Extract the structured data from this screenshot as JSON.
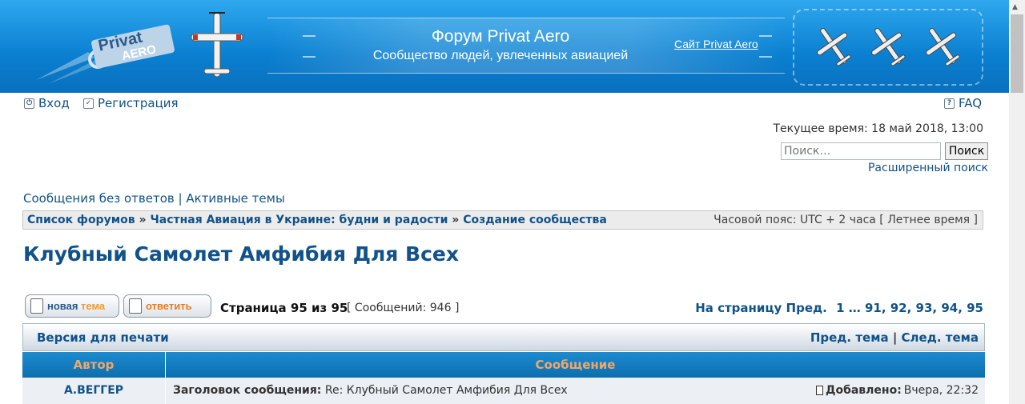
{
  "header": {
    "logo_text_line1": "Privat",
    "logo_text_line2": "AERO",
    "title": "Форум Privat Aero",
    "subtitle": "Сообщество людей, увлеченных авиацией",
    "site_link": "Сайт Privat Aero"
  },
  "nav": {
    "login": "Вход",
    "register": "Регистрация",
    "faq": "FAQ",
    "current_time": "Текущее время: 18 май 2018, 13:00",
    "search_placeholder": "Поиск…",
    "search_button": "Поиск",
    "advanced_search": "Расширенный поиск",
    "unanswered": "Сообщения без ответов",
    "separator": "|",
    "active_topics": "Активные темы"
  },
  "breadcrumb": {
    "items": [
      "Список форумов",
      "Частная Авиация в Украине: будни и радости",
      "Создание сообщества"
    ],
    "sep": "»",
    "timezone": "Часовой пояс: UTC + 2 часа [ Летнее время ]"
  },
  "topic": {
    "title": "Клубный Самолет Амфибия Для Всех",
    "new_topic_label_1": "новая ",
    "new_topic_label_2": "тема",
    "reply_label": "ответить",
    "page_info": "Страница 95 из 95",
    "post_count": "[ Сообщений: 946 ]",
    "pagination_prefix": "На страницу",
    "pagination_prev": "Пред.",
    "pagination_pages": "1 … 91, 92, 93, 94, 95"
  },
  "print_bar": {
    "print_version": "Версия для печати",
    "prev_topic": "Пред. тема",
    "pipe": "|",
    "next_topic": "След. тема"
  },
  "table": {
    "col_author": "Автор",
    "col_message": "Сообщение",
    "rows": [
      {
        "author": "А.ВЕГГЕР",
        "subject_label": "Заголовок сообщения:",
        "subject": "Re: Клубный Самолет Амфибия Для Всех",
        "date_label": "Добавлено:",
        "date": "Вчера, 22:32"
      }
    ]
  },
  "colors": {
    "header_blue": "#0a7fd0",
    "link_blue": "#105289",
    "th_orange": "#f0a76b",
    "new_topic_orange": "#f39c2c",
    "reply_orange": "#e87e1f"
  }
}
